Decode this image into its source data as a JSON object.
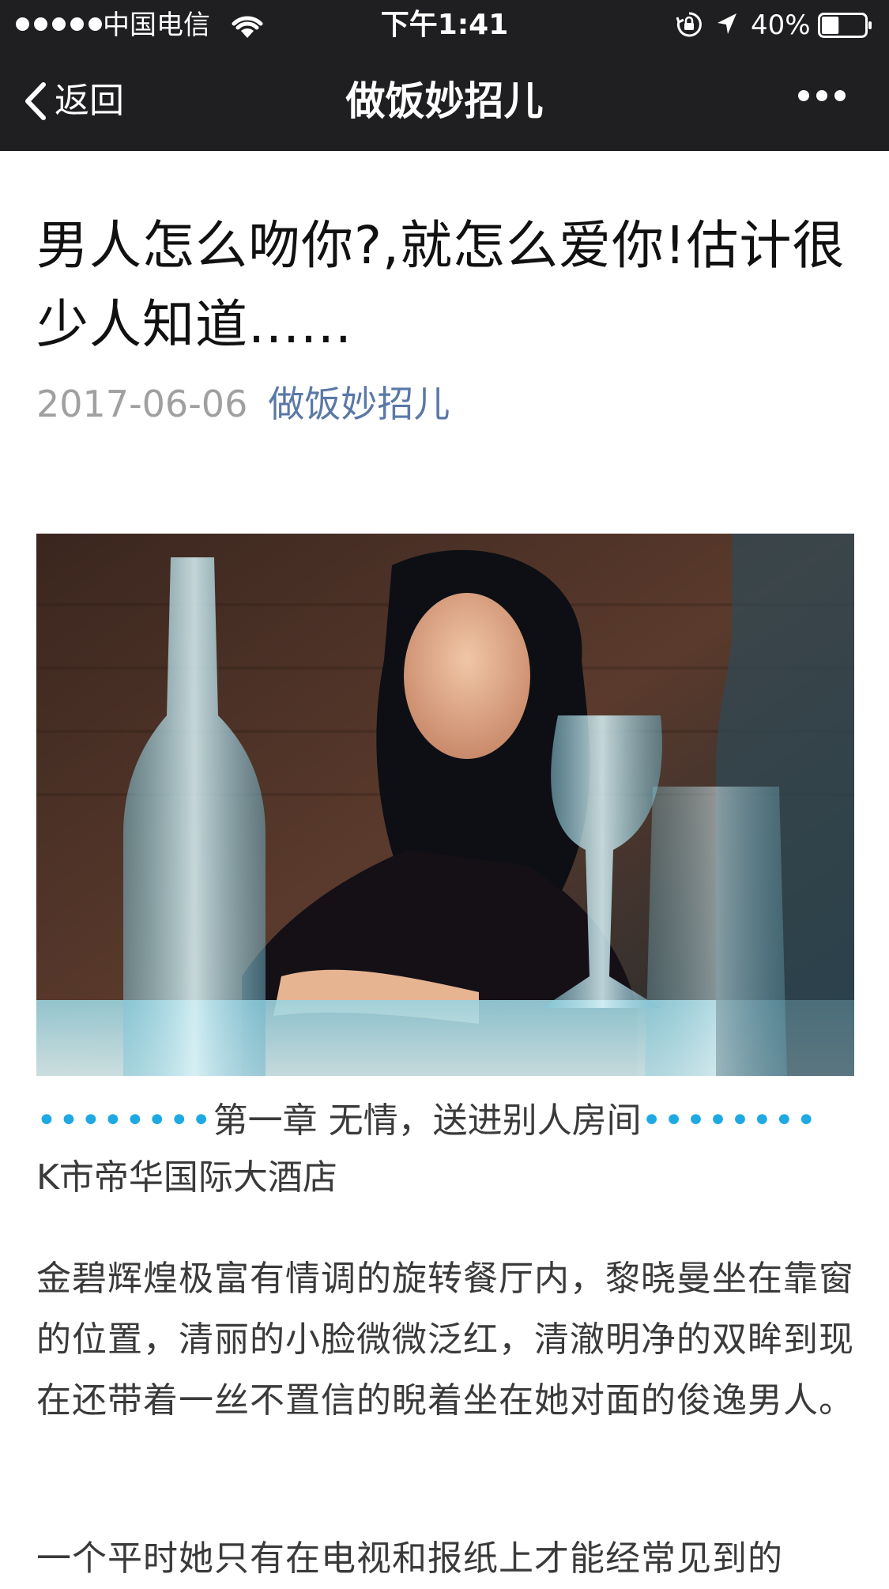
{
  "status_bar": {
    "carrier": "中国电信",
    "time": "下午1:41",
    "battery_percent": "40%",
    "battery_level": 0.4
  },
  "nav": {
    "back_label": "返回",
    "title": "做饭妙招儿"
  },
  "article": {
    "title": "男人怎么吻你?,就怎么爱你!估计很少人知道......",
    "date": "2017-06-06",
    "account": "做饭妙招儿",
    "chapter_dots_left": "••••••••",
    "chapter_title": "第一章 无情，送进别人房间",
    "chapter_dots_right": "••••••••",
    "location": "K市帝华国际大酒店",
    "paragraphs": [
      "金碧辉煌极富有情调的旋转餐厅内，黎晓曼坐在靠窗的位置，清丽的小脸微微泛红，清澈明净的双眸到现在还带着一丝不置信的睨着坐在她对面的俊逸男人。",
      "一个平时她只有在电视和报纸上才能经常见到的"
    ]
  },
  "colors": {
    "bar_bg": "#1f1f22",
    "link": "#5a78a8",
    "accent_dots": "#1fa9e3"
  }
}
